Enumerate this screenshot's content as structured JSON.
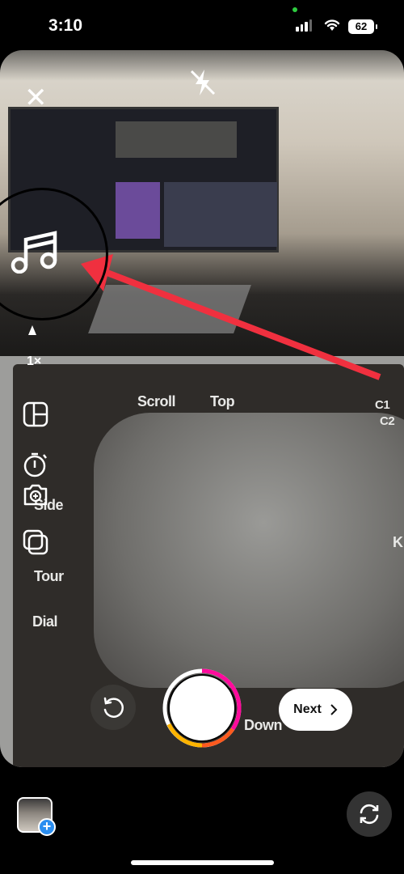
{
  "status_bar": {
    "time": "3:10",
    "battery": "62"
  },
  "camera": {
    "zoom_level": "1×",
    "photo_labels": [
      "Scroll",
      "Top",
      "C1",
      "C2",
      "Side",
      "Tour",
      "Dial",
      "Down",
      "K"
    ]
  },
  "controls": {
    "next_label": "Next"
  },
  "colors": {
    "annotation_arrow": "#f0303f",
    "ring_gradient": [
      "#ff0080",
      "#ff3b30",
      "#ffb000"
    ],
    "badge_blue": "#2b8ef0"
  }
}
